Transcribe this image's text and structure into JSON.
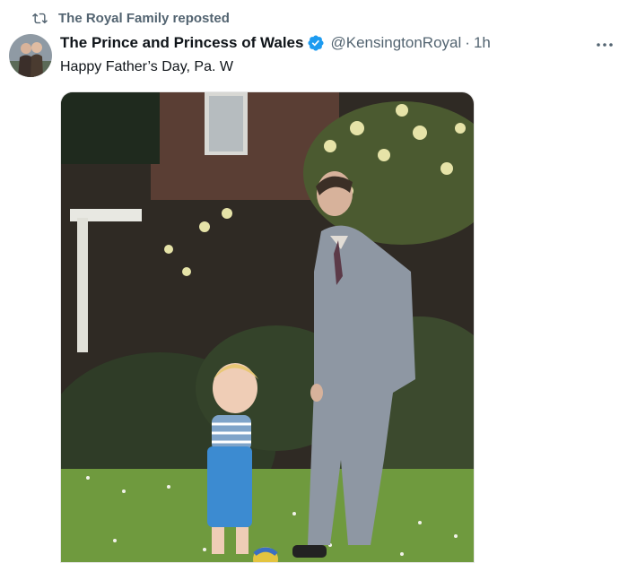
{
  "repost": {
    "label": "The Royal Family reposted"
  },
  "author": {
    "name": "The Prince and Princess of Wales",
    "handle": "@KensingtonRoyal",
    "time": "1h"
  },
  "tweet": {
    "text": "Happy Father’s Day, Pa. W"
  },
  "media": {
    "alt": "Photo: man in grey suit with toddler in blue shorts on a lawn with a ball"
  },
  "colors": {
    "verified": "#1d9bf0",
    "secondary_text": "#536471",
    "primary_text": "#0f1419"
  },
  "icons": {
    "repost": "repost-icon",
    "verified": "verified-badge-icon",
    "more": "more-options-icon"
  }
}
